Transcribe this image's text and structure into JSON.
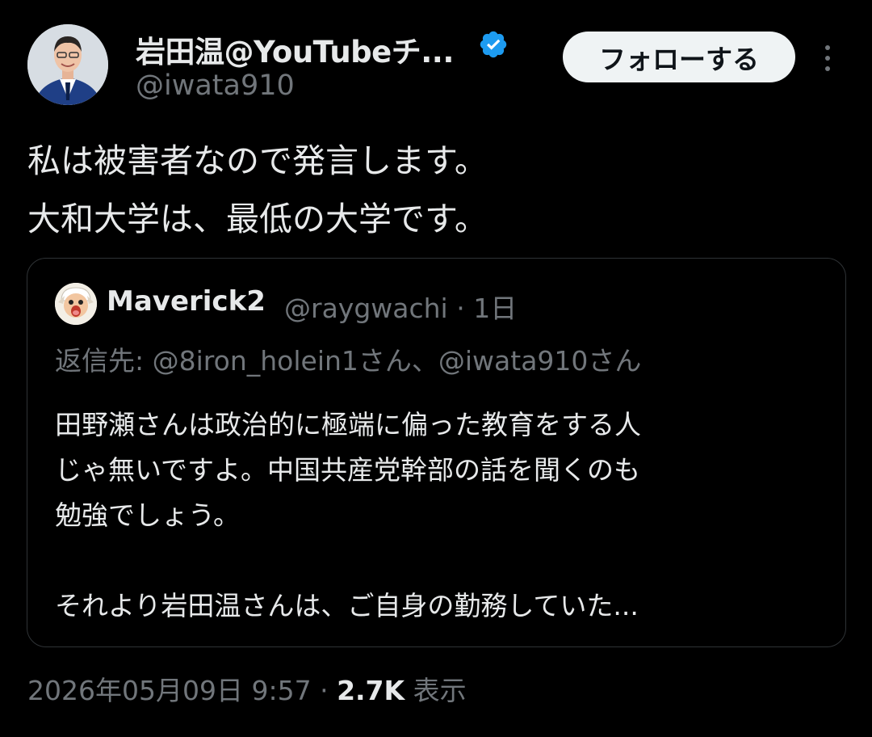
{
  "author": {
    "name": "岩田温@YouTubeチ...",
    "handle": "@iwata910"
  },
  "follow_button": {
    "label": "フォローする"
  },
  "tweet": {
    "lines": [
      "私は被害者なので発言します。",
      "大和大学は、最低の大学です。"
    ]
  },
  "quote": {
    "name": "Maverick2",
    "handle": "@raygwachi",
    "time": "· 1日",
    "reply_prefix": "返信先:",
    "reply_users": "@8iron_holein1さん、@iwata910さん",
    "body_lines": [
      "田野瀬さんは政治的に極端に偏った教育をする人",
      "じゃ無いですよ。中国共産党幹部の話を聞くのも",
      "勉強でしょう。",
      "それより岩田温さんは、ご自身の勤務していた..."
    ]
  },
  "meta": {
    "timestamp": "2026年05月09日 9:57",
    "separator": "·",
    "views_count": "2.7K",
    "views_label": "表示"
  },
  "colors": {
    "background": "#000000",
    "text": "#e7e9ea",
    "muted": "#71767b",
    "verified": "#1d9bf0",
    "border": "#2f3336"
  },
  "icons": [
    "verified-badge-icon",
    "more-options-icon"
  ]
}
